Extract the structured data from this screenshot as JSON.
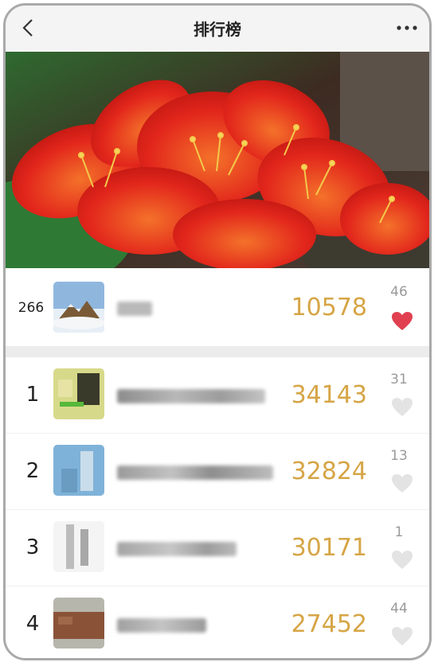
{
  "header": {
    "title": "排行榜",
    "back_icon": "chevron-left-icon",
    "more_icon": "more-dots-icon"
  },
  "hero": {
    "image": "red-clivia-flowers-photo"
  },
  "my_entry": {
    "rank": "266",
    "score": "10578",
    "likes": "46",
    "liked": true,
    "avatar": "mountain-landscape-avatar"
  },
  "ranking": [
    {
      "rank": "1",
      "score": "34143",
      "likes": "31",
      "liked": false
    },
    {
      "rank": "2",
      "score": "32824",
      "likes": "13",
      "liked": false
    },
    {
      "rank": "3",
      "score": "30171",
      "likes": "1",
      "liked": false
    },
    {
      "rank": "4",
      "score": "27452",
      "likes": "44",
      "liked": false
    }
  ],
  "colors": {
    "score": "#d6a545",
    "heart_active": "#e0404f",
    "heart_inactive": "#e3e3e3"
  }
}
